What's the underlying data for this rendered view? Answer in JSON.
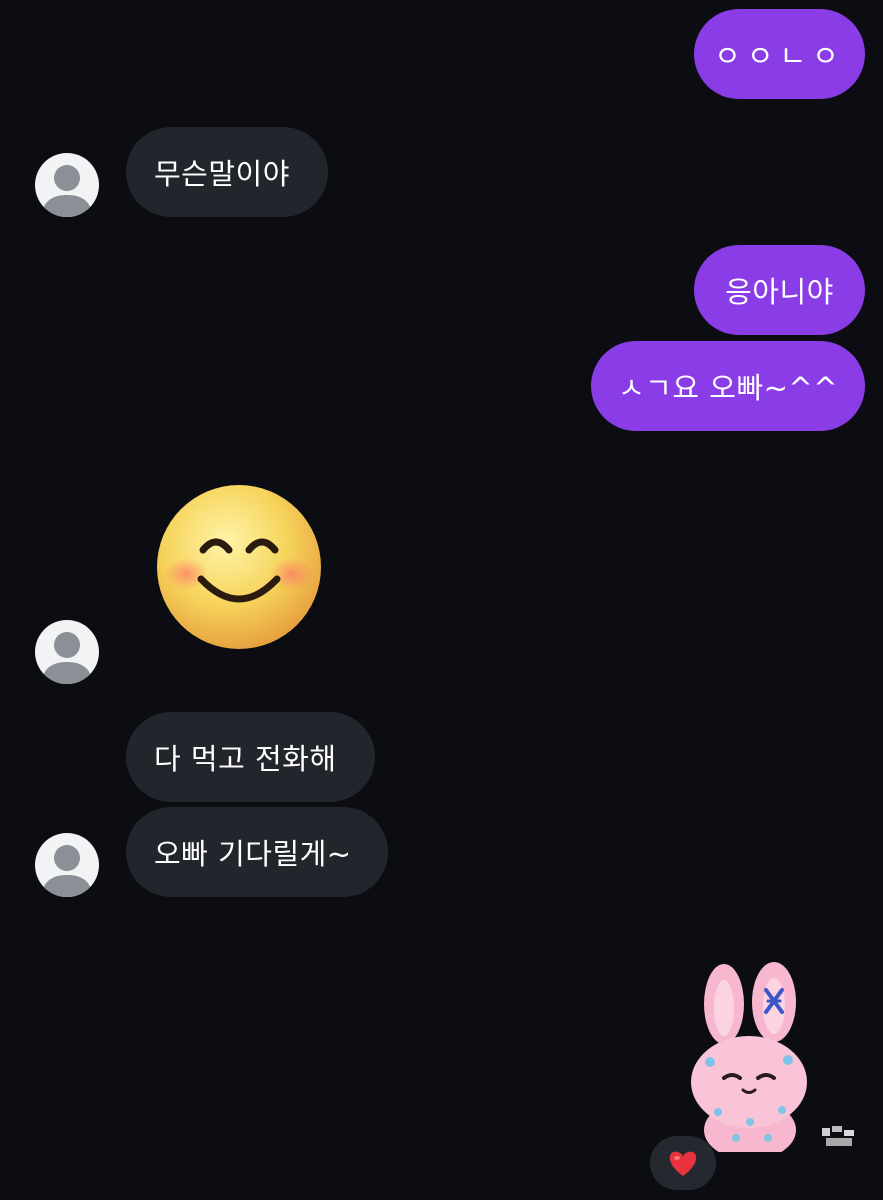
{
  "messages": {
    "m1": "ㅇㅇㄴㅇ",
    "m2": "무슨말이야",
    "m3": "응아니야",
    "m4": "ㅅㄱ요 오빠~^^",
    "m5": "다 먹고 전화해",
    "m6": "오빠 기다릴게~"
  },
  "colors": {
    "background": "#0b0d12",
    "sent_bubble": "#8a3ce6",
    "received_bubble": "#22252b",
    "avatar_bg": "#f2f3f5",
    "avatar_figure": "#8b9096"
  },
  "icons": {
    "avatar": "default-person-icon",
    "emoji_sticker": "smiling-face-with-blush",
    "bunny_sticker": "pink-bunny-sticker",
    "reaction": "red-heart-icon"
  }
}
